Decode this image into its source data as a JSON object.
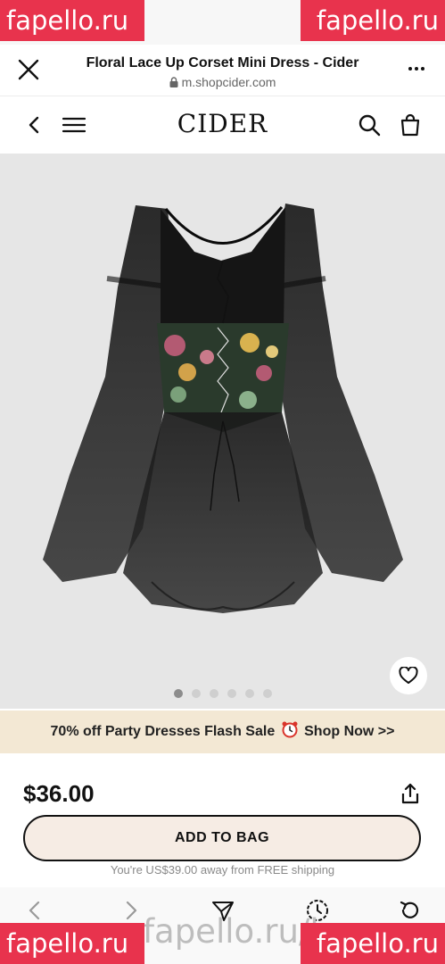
{
  "watermark": {
    "text": "fapello.ru",
    "bottom_url_text": "fapello.ru/lusa"
  },
  "browser": {
    "title": "Floral Lace Up Corset Mini Dress - Cider",
    "url": "m.shopcider.com",
    "close_icon": "close-icon",
    "more_icon": "more-icon"
  },
  "header": {
    "logo": "CIDER",
    "icons": [
      "back-icon",
      "menu-icon",
      "search-icon",
      "bag-icon"
    ]
  },
  "gallery": {
    "image_count": 6,
    "active_index": 0,
    "favorite_icon": "heart-icon"
  },
  "promo": {
    "text_before": "70% off Party Dresses Flash Sale",
    "text_after": "Shop Now >>",
    "icon": "alarm-clock-icon"
  },
  "product": {
    "price": "$36.00",
    "add_to_bag": "ADD TO BAG",
    "shipping_note": "You're US$39.00 away from FREE shipping",
    "share_icon": "share-icon"
  },
  "toolbar": {
    "icons": [
      "nav-back-icon",
      "nav-forward-icon",
      "send-icon",
      "history-icon",
      "reload-icon"
    ]
  },
  "colors": {
    "accent_watermark": "#e8334d",
    "promo_bg": "#f3e8d4",
    "button_bg": "#f6ece4",
    "gallery_bg": "#e6e6e6"
  }
}
